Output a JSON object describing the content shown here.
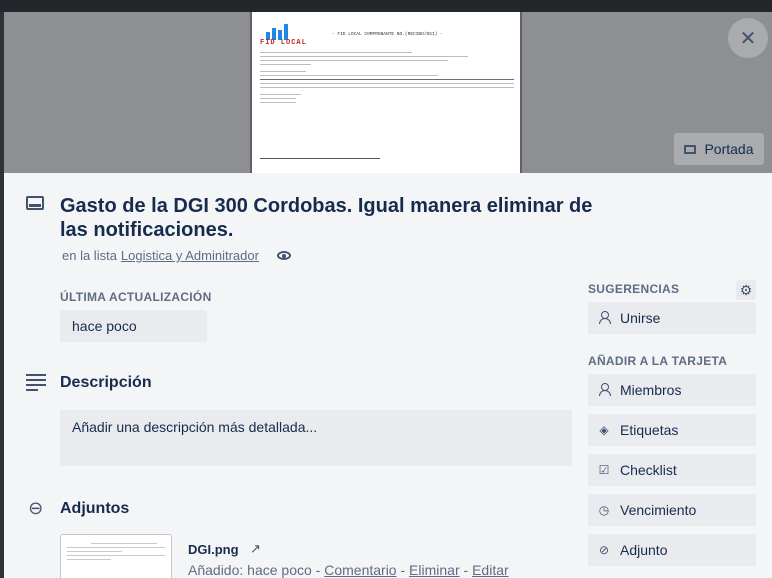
{
  "card": {
    "title": "Gasto de la DGI 300 Cordobas. Igual manera eliminar de las notificaciones.",
    "in_list_prefix": "en la lista",
    "list_name": "Logistica y Adminitrador",
    "cover_button": "Portada"
  },
  "cover_doc": {
    "brand": "FID LOCAL",
    "title": "- FID LOCAL COMPROBANTE NO.(RECIBO/DGI) -"
  },
  "updated": {
    "label": "ÚLTIMA ACTUALIZACIÓN",
    "value": "hace poco"
  },
  "description": {
    "heading": "Descripción",
    "placeholder": "Añadir una descripción más detallada..."
  },
  "attachments": {
    "heading": "Adjuntos",
    "file_name": "DGI.png",
    "added_prefix": "Añadido: hace poco - ",
    "comment": "Comentario",
    "sep1": " - ",
    "delete": "Eliminar",
    "sep2": " - ",
    "edit": "Editar"
  },
  "sidebar": {
    "suggestions_label": "SUGERENCIAS",
    "join": "Unirse",
    "add_label": "AÑADIR A LA TARJETA",
    "items": [
      {
        "label": "Miembros",
        "icon": "person-icon"
      },
      {
        "label": "Etiquetas",
        "icon": "tag-icon"
      },
      {
        "label": "Checklist",
        "icon": "checkbox-icon"
      },
      {
        "label": "Vencimiento",
        "icon": "clock-icon"
      },
      {
        "label": "Adjunto",
        "icon": "paperclip-icon"
      }
    ]
  },
  "colors": {
    "modal_bg": "#f4f5f7",
    "button_bg": "#e9ebee",
    "text": "#172b4d",
    "muted": "#5e6c84"
  }
}
